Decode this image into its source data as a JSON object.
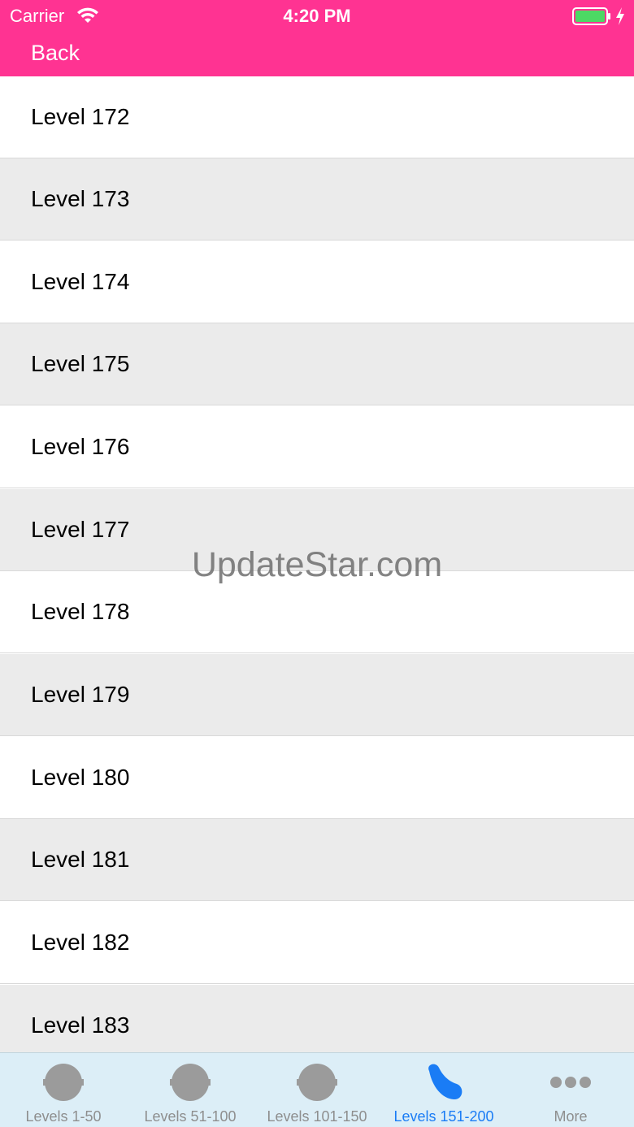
{
  "status_bar": {
    "carrier": "Carrier",
    "time": "4:20 PM"
  },
  "nav": {
    "back_label": "Back",
    "color": "#ff3392"
  },
  "levels": [
    "Level 172",
    "Level 173",
    "Level 174",
    "Level 175",
    "Level 176",
    "Level 177",
    "Level 178",
    "Level 179",
    "Level 180",
    "Level 181",
    "Level 182",
    "Level 183"
  ],
  "watermark": "UpdateStar.com",
  "tabs": [
    {
      "label": "Levels 1-50",
      "icon": "circle-icon",
      "active": false
    },
    {
      "label": "Levels 51-100",
      "icon": "circle-icon",
      "active": false
    },
    {
      "label": "Levels 101-150",
      "icon": "circle-icon",
      "active": false
    },
    {
      "label": "Levels 151-200",
      "icon": "jellybean-icon",
      "active": true
    },
    {
      "label": "More",
      "icon": "more-dots-icon",
      "active": false
    }
  ],
  "colors": {
    "active_tab": "#1a7cf5",
    "inactive_tab": "#8e8e8e",
    "tabbar_bg": "#dceef7",
    "row_alt": "#ebebeb"
  }
}
